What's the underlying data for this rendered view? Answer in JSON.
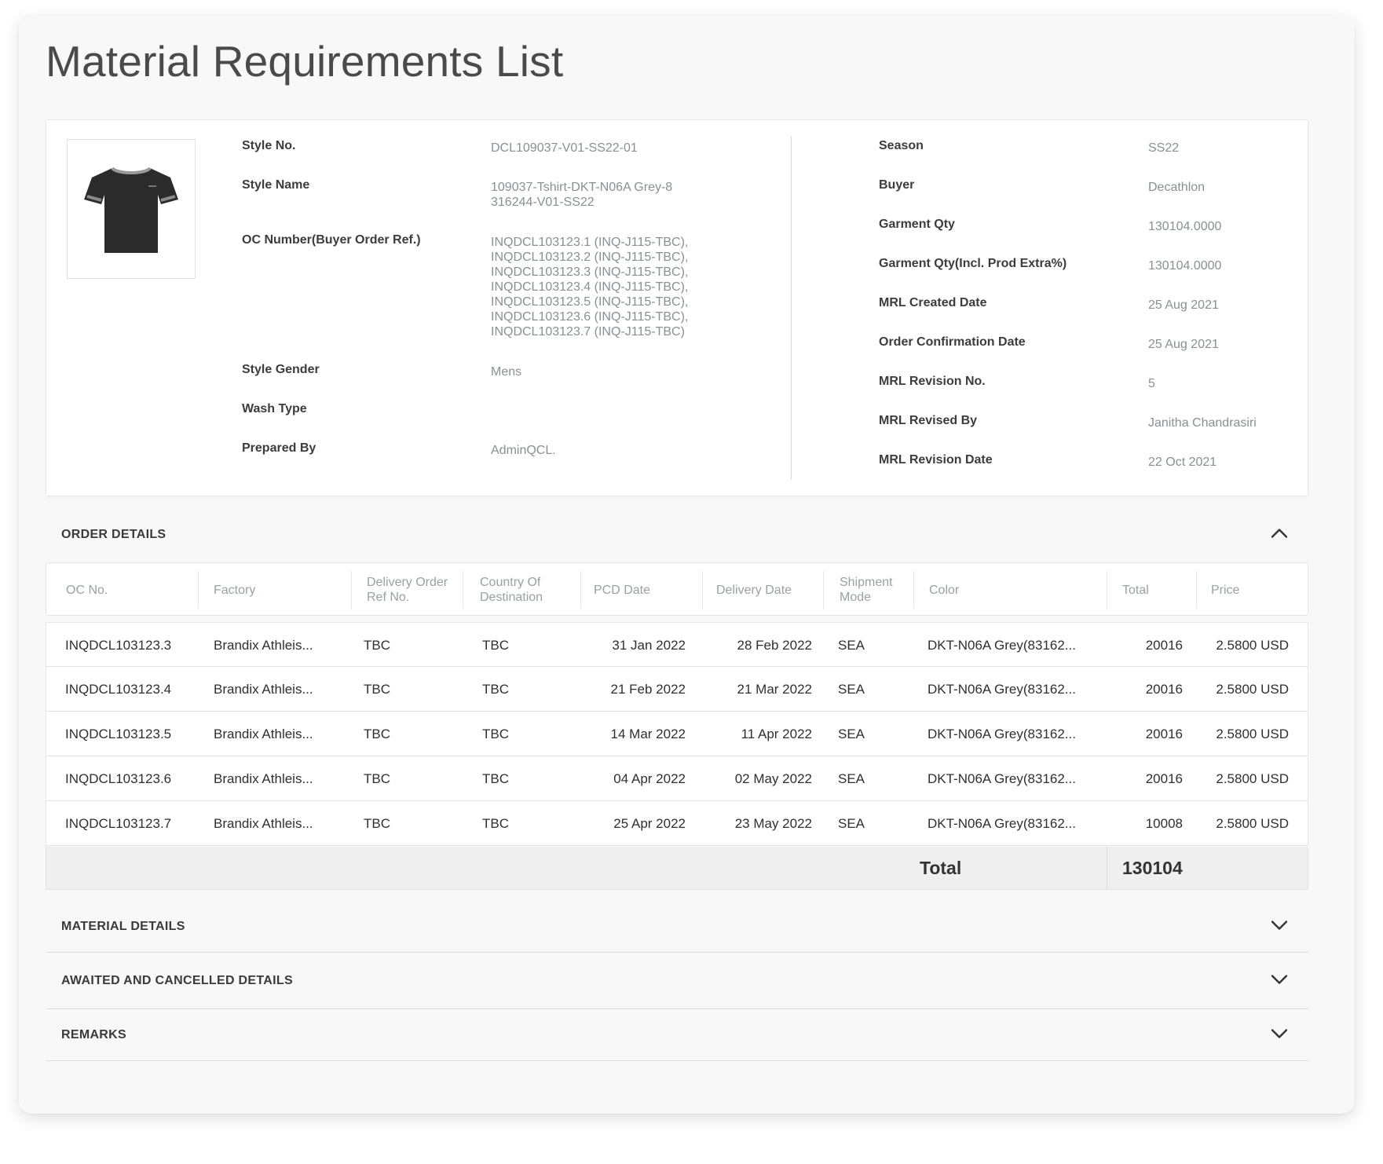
{
  "page_title": "Material Requirements List",
  "style_info": {
    "left": [
      {
        "label": "Style No.",
        "value": "DCL109037-V01-SS22-01"
      },
      {
        "label": "Style Name",
        "value": "109037-Tshirt-DKT-N06A Grey-8\n316244-V01-SS22"
      },
      {
        "label": "OC Number(Buyer Order Ref.)",
        "value": "INQDCL103123.1 (INQ-J115-TBC),\nINQDCL103123.2 (INQ-J115-TBC),\nINQDCL103123.3 (INQ-J115-TBC),\nINQDCL103123.4 (INQ-J115-TBC),\nINQDCL103123.5 (INQ-J115-TBC),\nINQDCL103123.6 (INQ-J115-TBC),\nINQDCL103123.7 (INQ-J115-TBC)"
      },
      {
        "label": "Style Gender",
        "value": "Mens"
      },
      {
        "label": "Wash Type",
        "value": ""
      },
      {
        "label": "Prepared By",
        "value": "AdminQCL."
      }
    ],
    "right": [
      {
        "label": "Season",
        "value": "SS22"
      },
      {
        "label": "Buyer",
        "value": "Decathlon"
      },
      {
        "label": "Garment Qty",
        "value": "130104.0000"
      },
      {
        "label": "Garment Qty(Incl. Prod Extra%)",
        "value": "130104.0000"
      },
      {
        "label": "MRL Created Date",
        "value": "25 Aug 2021"
      },
      {
        "label": "Order Confirmation Date",
        "value": "25 Aug 2021"
      },
      {
        "label": "MRL Revision No.",
        "value": "5"
      },
      {
        "label": "MRL Revised By",
        "value": "Janitha Chandrasiri"
      },
      {
        "label": "MRL Revision Date",
        "value": "22 Oct 2021"
      }
    ]
  },
  "sections": {
    "order_details": "ORDER DETAILS",
    "material_details": "MATERIAL DETAILS",
    "awaited_cancelled": "AWAITED AND CANCELLED DETAILS",
    "remarks": "REMARKS"
  },
  "order_table": {
    "columns": [
      "OC No.",
      "Factory",
      "Delivery Order\nRef No.",
      "Country Of\nDestination",
      "PCD Date",
      "Delivery Date",
      "Shipment\nMode",
      "Color",
      "Total",
      "Price"
    ],
    "rows": [
      [
        "INQDCL103123.3",
        "Brandix Athleis...",
        "TBC",
        "TBC",
        "31 Jan 2022",
        "28 Feb 2022",
        "SEA",
        "DKT-N06A Grey(83162...",
        "20016",
        "2.5800 USD"
      ],
      [
        "INQDCL103123.4",
        "Brandix Athleis...",
        "TBC",
        "TBC",
        "21 Feb 2022",
        "21 Mar 2022",
        "SEA",
        "DKT-N06A Grey(83162...",
        "20016",
        "2.5800 USD"
      ],
      [
        "INQDCL103123.5",
        "Brandix Athleis...",
        "TBC",
        "TBC",
        "14 Mar 2022",
        "11 Apr 2022",
        "SEA",
        "DKT-N06A Grey(83162...",
        "20016",
        "2.5800 USD"
      ],
      [
        "INQDCL103123.6",
        "Brandix Athleis...",
        "TBC",
        "TBC",
        "04 Apr 2022",
        "02 May 2022",
        "SEA",
        "DKT-N06A Grey(83162...",
        "20016",
        "2.5800 USD"
      ],
      [
        "INQDCL103123.7",
        "Brandix Athleis...",
        "TBC",
        "TBC",
        "25 Apr 2022",
        "23 May 2022",
        "SEA",
        "DKT-N06A Grey(83162...",
        "10008",
        "2.5800 USD"
      ]
    ],
    "total_label": "Total",
    "total_value": "130104"
  },
  "icons": {
    "product_image": "tshirt-icon",
    "collapse": "chevron-up-icon",
    "expand": "chevron-down-icon"
  }
}
